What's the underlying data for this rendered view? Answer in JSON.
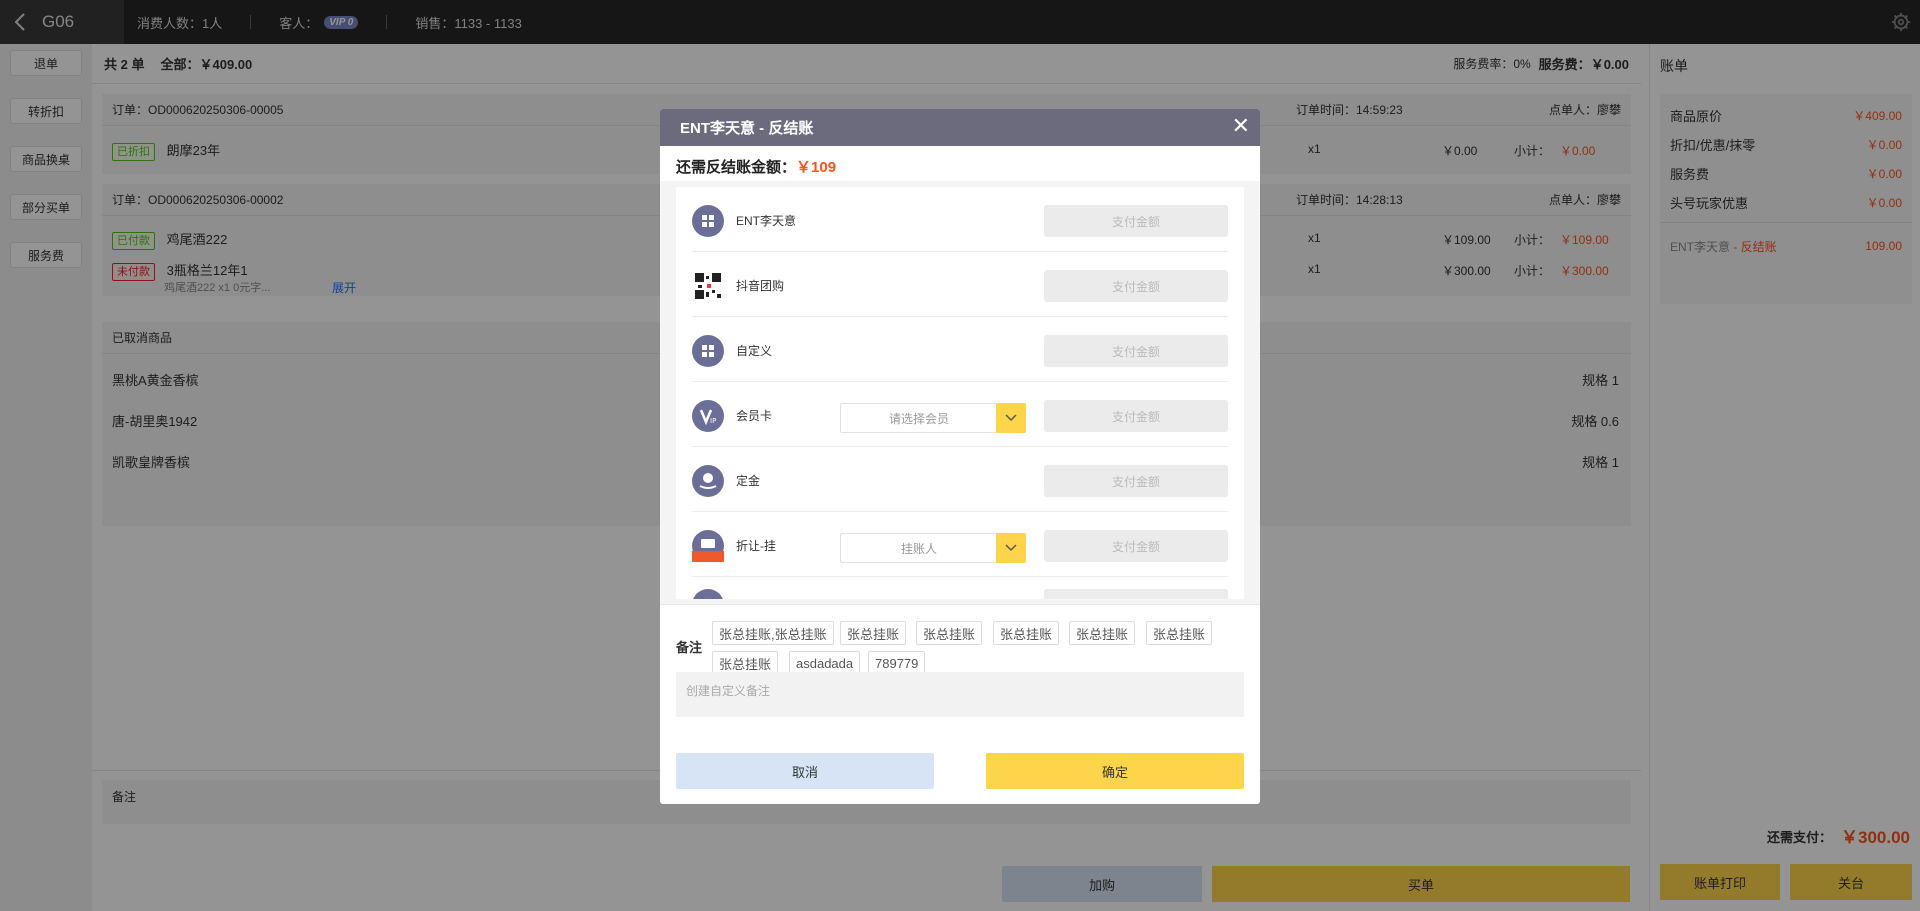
{
  "topbar": {
    "back_label": "G06",
    "consumers": "消费人数：1人",
    "guest_label": "客人：",
    "vip_badge": "VIP 0",
    "sales": "销售：1133 - 1133"
  },
  "sidebar": {
    "items": [
      "退单",
      "转折扣",
      "商品换桌",
      "部分买单",
      "服务费"
    ]
  },
  "main": {
    "count": "共 2 单",
    "total_label": "全部：",
    "total_value": "￥409.00",
    "service_rate": "服务费率：0%",
    "service_fee_label": "服务费：",
    "service_fee_value": "￥0.00",
    "orders": [
      {
        "id": "订单：OD000620250306-00005",
        "time": "订单时间：14:59:23",
        "waiter": "点单人：廖攀",
        "items": [
          {
            "badge": "已折扣",
            "name": "朗摩23年",
            "qty": "x1",
            "price": "￥0.00",
            "subtotal_label": "小计：",
            "subtotal": "￥0.00"
          }
        ]
      },
      {
        "id": "订单：OD000620250306-00002",
        "time": "订单时间：14:28:13",
        "waiter": "点单人：廖攀",
        "items": [
          {
            "badge": "已付款",
            "name": "鸡尾酒222",
            "qty": "x1",
            "price": "￥109.00",
            "subtotal_label": "小计：",
            "subtotal": "￥109.00"
          },
          {
            "badge": "未付款",
            "name": "3瓶格兰12年1",
            "qty": "x1",
            "price": "￥300.00",
            "subtotal_label": "小计：",
            "subtotal": "￥300.00",
            "sub": "鸡尾酒222 x1   0元字...",
            "expand": "展开"
          }
        ]
      }
    ],
    "cancelled_title": "已取消商品",
    "cancelled": [
      {
        "name": "黑桃A黄金香槟",
        "spec": "规格 1"
      },
      {
        "name": "唐-胡里奥1942",
        "spec": "规格 0.6"
      },
      {
        "name": "凯歌皇牌香槟",
        "spec": "规格 1"
      }
    ],
    "remark_label": "备注",
    "add_button": "加购",
    "pay_button": "买单"
  },
  "right": {
    "title": "账单",
    "rows": [
      {
        "label": "商品原价",
        "value": "￥409.00"
      },
      {
        "label": "折扣/优惠/抹零",
        "value": "￥0.00"
      },
      {
        "label": "服务费",
        "value": "￥0.00"
      },
      {
        "label": "头号玩家优惠",
        "value": "￥0.00"
      }
    ],
    "payment_label": "ENT李天意",
    "payment_tag": " - 反结账",
    "payment_value": "109.00",
    "due_label": "还需支付：",
    "due_value": "￥300.00",
    "print_button": "账单打印",
    "close_button": "关台"
  },
  "modal": {
    "title": "ENT李天意 - 反结账",
    "close": "✕",
    "due_label": "还需反结账金额：",
    "due_value": "￥109",
    "methods": [
      {
        "name": "ENT李天意",
        "icon": "apps-icon",
        "amount_placeholder": "支付金额"
      },
      {
        "name": "抖音团购",
        "icon": "qrcode-icon",
        "amount_placeholder": "支付金额"
      },
      {
        "name": "自定义",
        "icon": "apps-icon",
        "amount_placeholder": "支付金额"
      },
      {
        "name": "会员卡",
        "icon": "vip-icon",
        "select_placeholder": "请选择会员",
        "amount_placeholder": "支付金额"
      },
      {
        "name": "定金",
        "icon": "deposit-icon",
        "amount_placeholder": "支付金额"
      },
      {
        "name": "折让-挂",
        "icon": "ticket-icon",
        "select_placeholder": "挂账人",
        "amount_placeholder": "支付金额"
      }
    ],
    "note_label": "备注",
    "tags": [
      "张总挂账,张总挂账",
      "张总挂账",
      "张总挂账",
      "张总挂账",
      "张总挂账",
      "张总挂账",
      "张总挂账",
      "asdadada",
      "789779"
    ],
    "memo_placeholder": "创建自定义备注",
    "cancel": "取消",
    "confirm": "确定"
  },
  "colors": {
    "accent": "#fdd54a",
    "price": "#fa541c",
    "modal_header": "#6b6b7d"
  }
}
